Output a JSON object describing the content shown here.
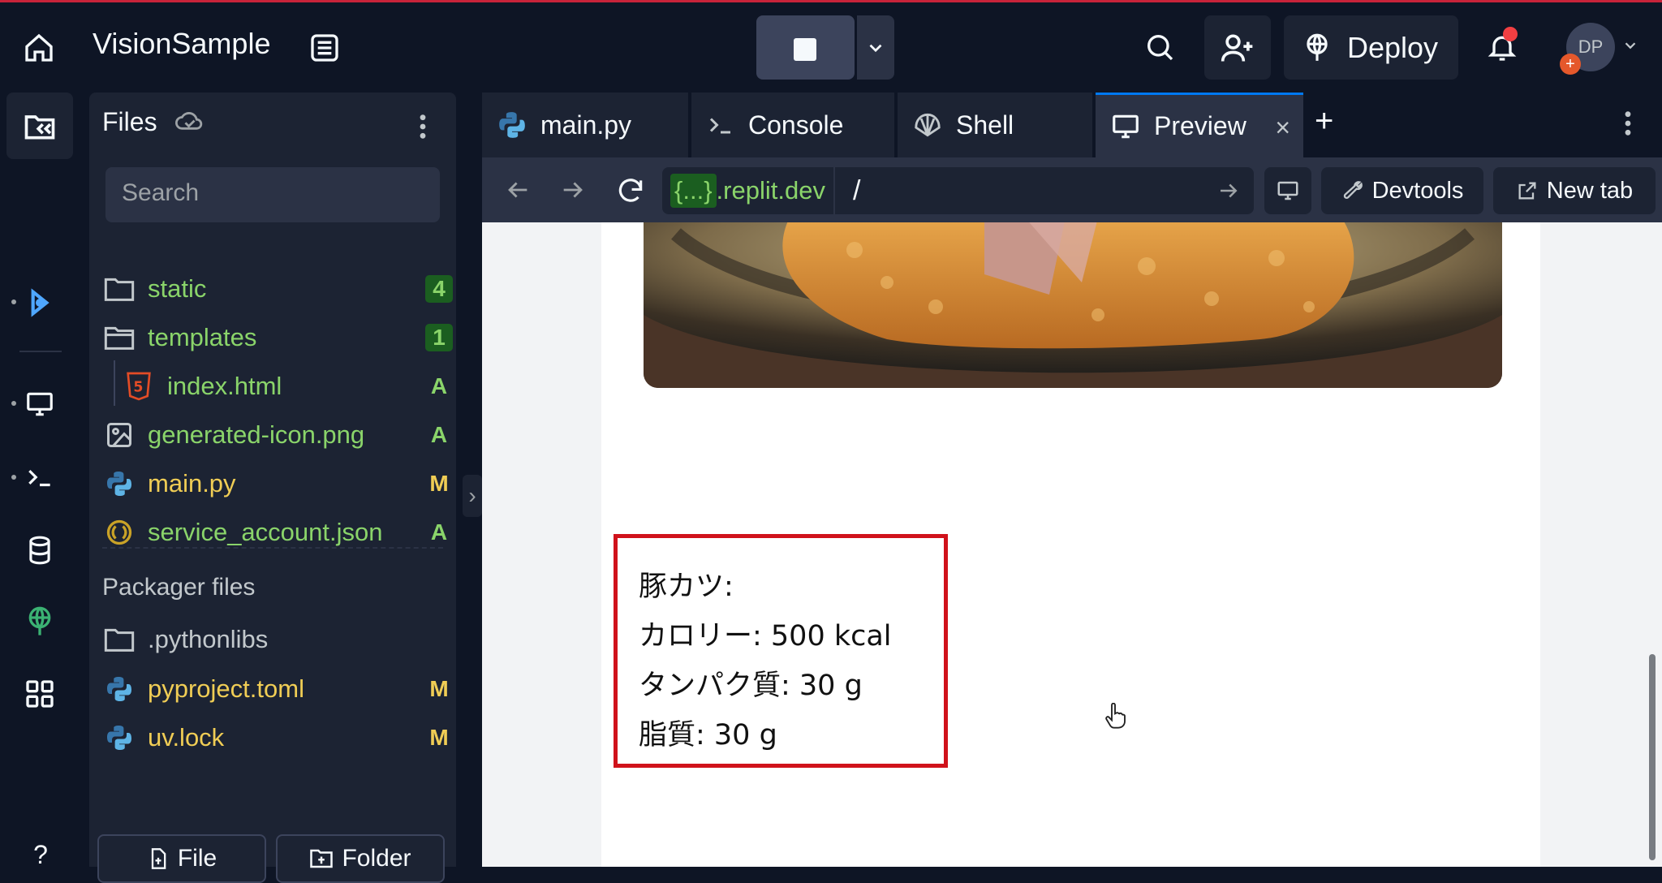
{
  "header": {
    "title": "VisionSample",
    "deploy_label": "Deploy",
    "avatar_initials": "DP",
    "avatar_badge": "+"
  },
  "files_panel": {
    "title": "Files",
    "search_placeholder": "Search",
    "items": [
      {
        "name": "static",
        "badge": "4",
        "icon": "folder-icon"
      },
      {
        "name": "templates",
        "badge": "1",
        "icon": "folder-open-icon"
      },
      {
        "name": "index.html",
        "badge": "A",
        "icon": "html5-icon"
      },
      {
        "name": "generated-icon.png",
        "badge": "A",
        "icon": "image-icon"
      },
      {
        "name": "main.py",
        "badge": "M",
        "icon": "python-icon"
      },
      {
        "name": "service_account.json",
        "badge": "A",
        "icon": "json-icon"
      }
    ],
    "packager_title": "Packager files",
    "packager_items": [
      {
        "name": ".pythonlibs",
        "badge": "",
        "icon": "folder-icon"
      },
      {
        "name": "pyproject.toml",
        "badge": "M",
        "icon": "python-icon"
      },
      {
        "name": "uv.lock",
        "badge": "M",
        "icon": "python-icon"
      }
    ],
    "new_file_label": "File",
    "new_folder_label": "Folder"
  },
  "tabs": [
    {
      "label": "main.py",
      "icon": "python-icon"
    },
    {
      "label": "Console",
      "icon": "terminal-icon"
    },
    {
      "label": "Shell",
      "icon": "shell-icon"
    },
    {
      "label": "Preview",
      "icon": "monitor-icon",
      "active": true
    }
  ],
  "navbar": {
    "url_braces": "{...}",
    "url_host": ".replit.dev",
    "url_path": "/",
    "devtools_label": "Devtools",
    "newtab_label": "New tab"
  },
  "preview": {
    "result_lines": [
      "豚カツ:",
      "カロリー: 500 kcal",
      "タンパク質: 30 g",
      "脂質: 30 g"
    ]
  },
  "colors": {
    "bg": "#0e1525",
    "panel": "#1c2333",
    "accent_green": "#8ad46a",
    "accent_yellow": "#f0cd55",
    "result_border": "#d0121b"
  }
}
